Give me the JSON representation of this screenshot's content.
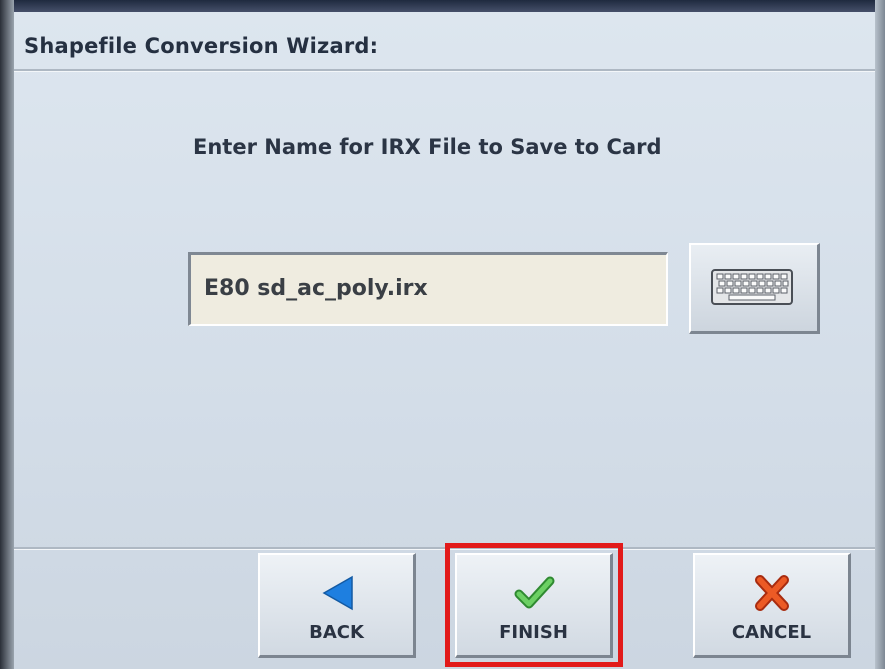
{
  "dialog": {
    "title": "Shapefile Conversion Wizard:",
    "prompt": "Enter Name for IRX File to Save to Card"
  },
  "filename_input": {
    "value": "E80 sd_ac_poly.irx"
  },
  "keyboard_button": {
    "icon": "keyboard-icon"
  },
  "buttons": {
    "back": {
      "label": "BACK",
      "icon": "left-arrow-icon",
      "color": "#1e7fe0"
    },
    "finish": {
      "label": "FINISH",
      "icon": "checkmark-icon",
      "color": "#4cb948"
    },
    "cancel": {
      "label": "CANCEL",
      "icon": "x-mark-icon",
      "color": "#e0451c"
    }
  },
  "highlight": {
    "target": "finish",
    "color": "#e21a1a"
  }
}
